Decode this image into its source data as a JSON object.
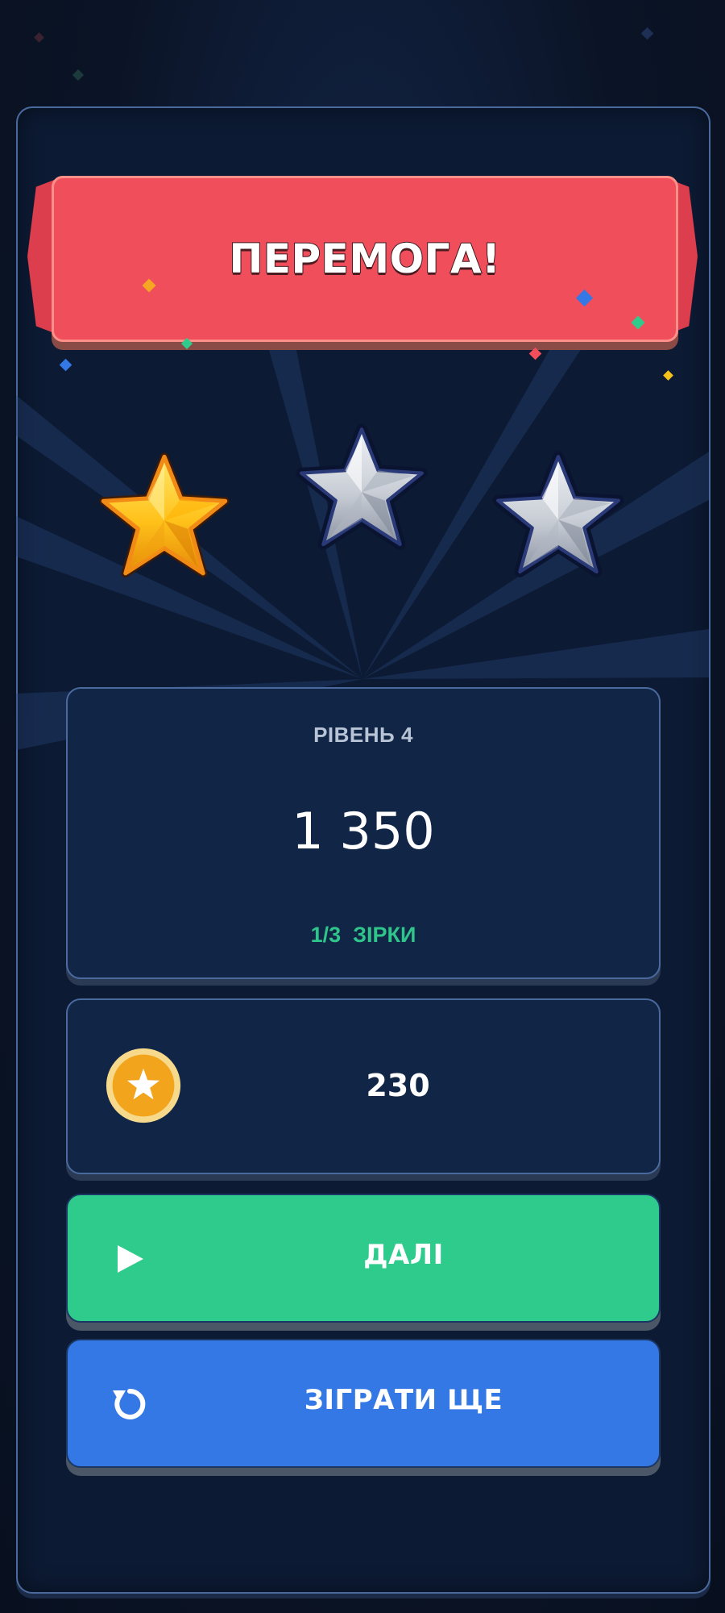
{
  "banner": {
    "title": "ПЕРЕМОГА!"
  },
  "stars": {
    "earned": 1,
    "total": 3
  },
  "score_card": {
    "level_label": "РІВЕНЬ 4",
    "score": "1 350",
    "stars_text": "1/3  ЗІРКИ"
  },
  "coins": {
    "amount": "230",
    "icon": "coin-star-icon"
  },
  "buttons": {
    "next_label": "ДАЛІ",
    "next_icon": "play-icon",
    "replay_label": "ЗІГРАТИ ЩЕ",
    "replay_icon": "restart-icon"
  },
  "colors": {
    "banner": "#f14e5c",
    "next_button": "#2ecb8c",
    "replay_button": "#3478e6",
    "stars_text": "#2fc48a",
    "gold_star": "#ffc21a",
    "silver_star": "#c9ced6"
  }
}
